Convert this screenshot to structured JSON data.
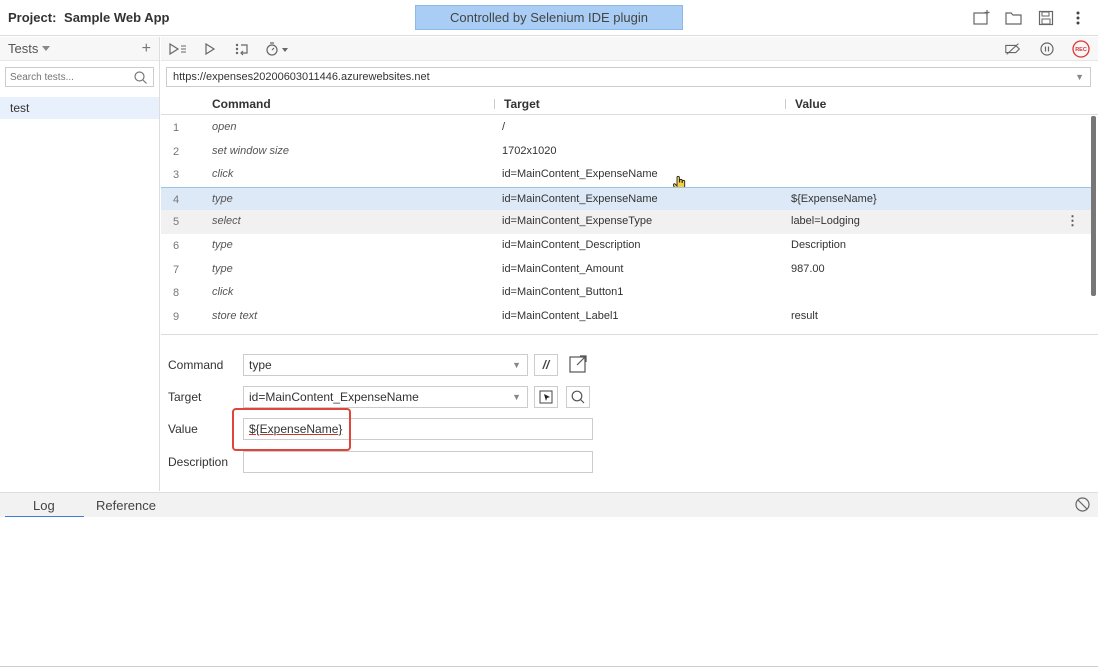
{
  "header": {
    "project_label": "Project:",
    "project_name": "Sample Web App",
    "banner": "Controlled by Selenium IDE plugin"
  },
  "sidebar": {
    "tests_label": "Tests",
    "search_placeholder": "Search tests...",
    "tests": [
      "test"
    ]
  },
  "toolbar": {
    "rec_label": "REC"
  },
  "url": "https://expenses20200603011446.azurewebsites.net",
  "table": {
    "headers": {
      "command": "Command",
      "target": "Target",
      "value": "Value"
    },
    "rows": [
      {
        "num": "1",
        "command": "open",
        "target": "/",
        "value": ""
      },
      {
        "num": "2",
        "command": "set window size",
        "target": "1702x1020",
        "value": ""
      },
      {
        "num": "3",
        "command": "click",
        "target": "id=MainContent_ExpenseName",
        "value": ""
      },
      {
        "num": "4",
        "command": "type",
        "target": "id=MainContent_ExpenseName",
        "value": "${ExpenseName}"
      },
      {
        "num": "5",
        "command": "select",
        "target": "id=MainContent_ExpenseType",
        "value": "label=Lodging"
      },
      {
        "num": "6",
        "command": "type",
        "target": "id=MainContent_Description",
        "value": "Description"
      },
      {
        "num": "7",
        "command": "type",
        "target": "id=MainContent_Amount",
        "value": "987.00"
      },
      {
        "num": "8",
        "command": "click",
        "target": "id=MainContent_Button1",
        "value": ""
      },
      {
        "num": "9",
        "command": "store text",
        "target": "id=MainContent_Label1",
        "value": "result"
      }
    ]
  },
  "editor": {
    "command_label": "Command",
    "command_value": "type",
    "target_label": "Target",
    "target_value": "id=MainContent_ExpenseName",
    "value_label": "Value",
    "value_value": "${ExpenseName}",
    "description_label": "Description",
    "description_value": "",
    "comment_btn": "//"
  },
  "bottom": {
    "log_tab": "Log",
    "reference_tab": "Reference"
  }
}
